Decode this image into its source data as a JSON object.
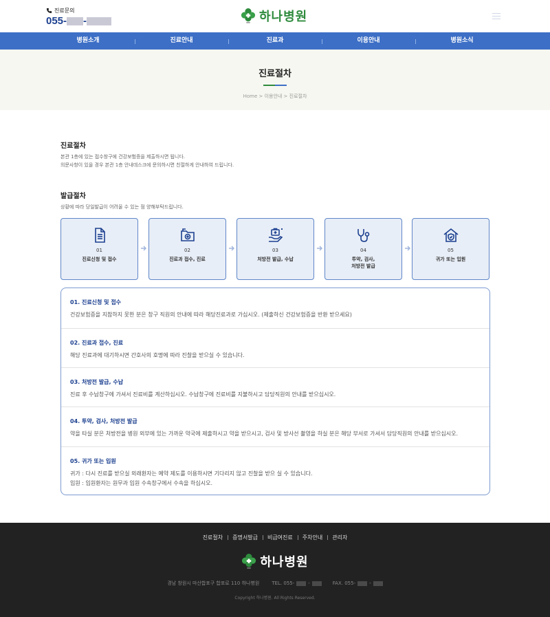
{
  "header": {
    "phone_label": "진료문의",
    "phone_prefix": "055-",
    "phone_sep": "-",
    "logo_text": "하나병원"
  },
  "nav": {
    "items": [
      "병원소개",
      "진료안내",
      "진료과",
      "이용안내",
      "병원소식"
    ]
  },
  "hero": {
    "title": "진료절차",
    "breadcrumb": "Home > 이용안내 > 진료절차"
  },
  "procedure": {
    "title": "진료절차",
    "lines": [
      "본관 1층에 있는 접수창구에 건강보험증을 제출하시면 됩니다.",
      "의문사항이 있을 경우 본관 1층 안내데스크에 문의하시면 친절하게 안내하여 드립니다."
    ]
  },
  "issue": {
    "title": "발급절차",
    "text": "상황에 따라 당일발급이 어려울 수 있는 점 양해부탁드립니다."
  },
  "steps": [
    {
      "num": "01",
      "label": "진료신청 및 접수",
      "icon": "document-icon"
    },
    {
      "num": "02",
      "label": "진료과 접수, 진료",
      "icon": "medical-folder-icon"
    },
    {
      "num": "03",
      "label": "처방전 발급, 수납",
      "icon": "medical-kit-hand-icon"
    },
    {
      "num": "04",
      "label": "투약, 검사,",
      "label2": "처방전 발급",
      "icon": "stethoscope-icon"
    },
    {
      "num": "05",
      "label": "귀가 또는 입원",
      "icon": "house-shield-icon"
    }
  ],
  "details": [
    {
      "title": "01. 진료신청 및 접수",
      "lines": [
        "건강보험증을 지참하지 못한 분은 창구 직원의 안내에 따라 해당진료과로 가십시오. (제출하신 건강보험증을 반환 받으세요)"
      ]
    },
    {
      "title": "02. 진료과 접수, 진료",
      "lines": [
        "해당 진료과에 대기하시면 간호사의 호명에 따라 진찰을 받으실 수 있습니다."
      ]
    },
    {
      "title": "03. 처방전 발급, 수납",
      "lines": [
        "진료 후 수납창구에 가셔서 진료비를 계산하십시오. 수납창구에 진료비를 지불하시고 담당직원의 안내를 받으십시오."
      ]
    },
    {
      "title": "04. 투약, 검사, 처방전 발급",
      "lines": [
        "약을 타실 분은 처방전을 병원 외부에 있는 가까운 약국에 제출하시고 약을 받으시고, 검사 및 방사선 촬영을 하실 분은 해당 부서로 가셔서 담당직원의 안내를 받으십시오."
      ]
    },
    {
      "title": "05. 귀가 또는 입원",
      "lines": [
        "귀가 : 다시 진료를 받으실 외래환자는 예약 제도를 이용하시면 기다리지 않고 진찰을 받으 실 수 있습니다.",
        "입원 : 입원환자는 원무과 입원 수속창구에서 수속을 하십시오."
      ]
    }
  ],
  "footer": {
    "links": [
      "진료절차",
      "증명서발급",
      "비급여진료",
      "주차안내",
      "관리자"
    ],
    "logo_text": "하나병원",
    "address": "경남 창원시 마산합포구 합포로 110 하나병원",
    "tel_label": "TEL. 055-",
    "fax_label": "FAX. 055-",
    "copyright": "Copyright 하나병원. All Rights Reserved."
  },
  "colors": {
    "nav_blue": "#3d6fc6",
    "brand_green": "#2e8b3d",
    "title_navy": "#1b3f8f",
    "footer_bg": "#222222"
  }
}
